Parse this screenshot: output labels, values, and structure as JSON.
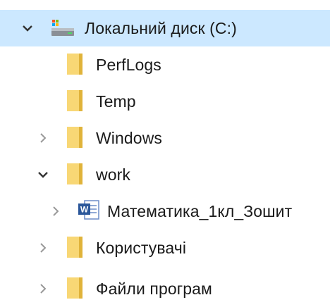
{
  "tree": {
    "items": [
      {
        "label": "Локальний диск (C:)",
        "icon": "drive-icon",
        "expander": "expanded"
      },
      {
        "label": "PerfLogs",
        "icon": "folder-icon",
        "expander": "none"
      },
      {
        "label": "Temp",
        "icon": "folder-icon",
        "expander": "none"
      },
      {
        "label": "Windows",
        "icon": "folder-icon",
        "expander": "collapsed"
      },
      {
        "label": "work",
        "icon": "folder-icon",
        "expander": "expanded"
      },
      {
        "label": "Математика_1кл_Зошит",
        "icon": "word-document-icon",
        "expander": "collapsed"
      },
      {
        "label": "Користувачі",
        "icon": "folder-icon",
        "expander": "collapsed"
      },
      {
        "label": "Файли програм",
        "icon": "folder-icon",
        "expander": "collapsed"
      }
    ]
  },
  "colors": {
    "selected_background": "#cce8ff",
    "folder_yellow": "#f8d775",
    "folder_shadow": "#e0b33a",
    "word_blue": "#2b579a",
    "chevron": "#555555",
    "chevron_muted": "#999999"
  }
}
